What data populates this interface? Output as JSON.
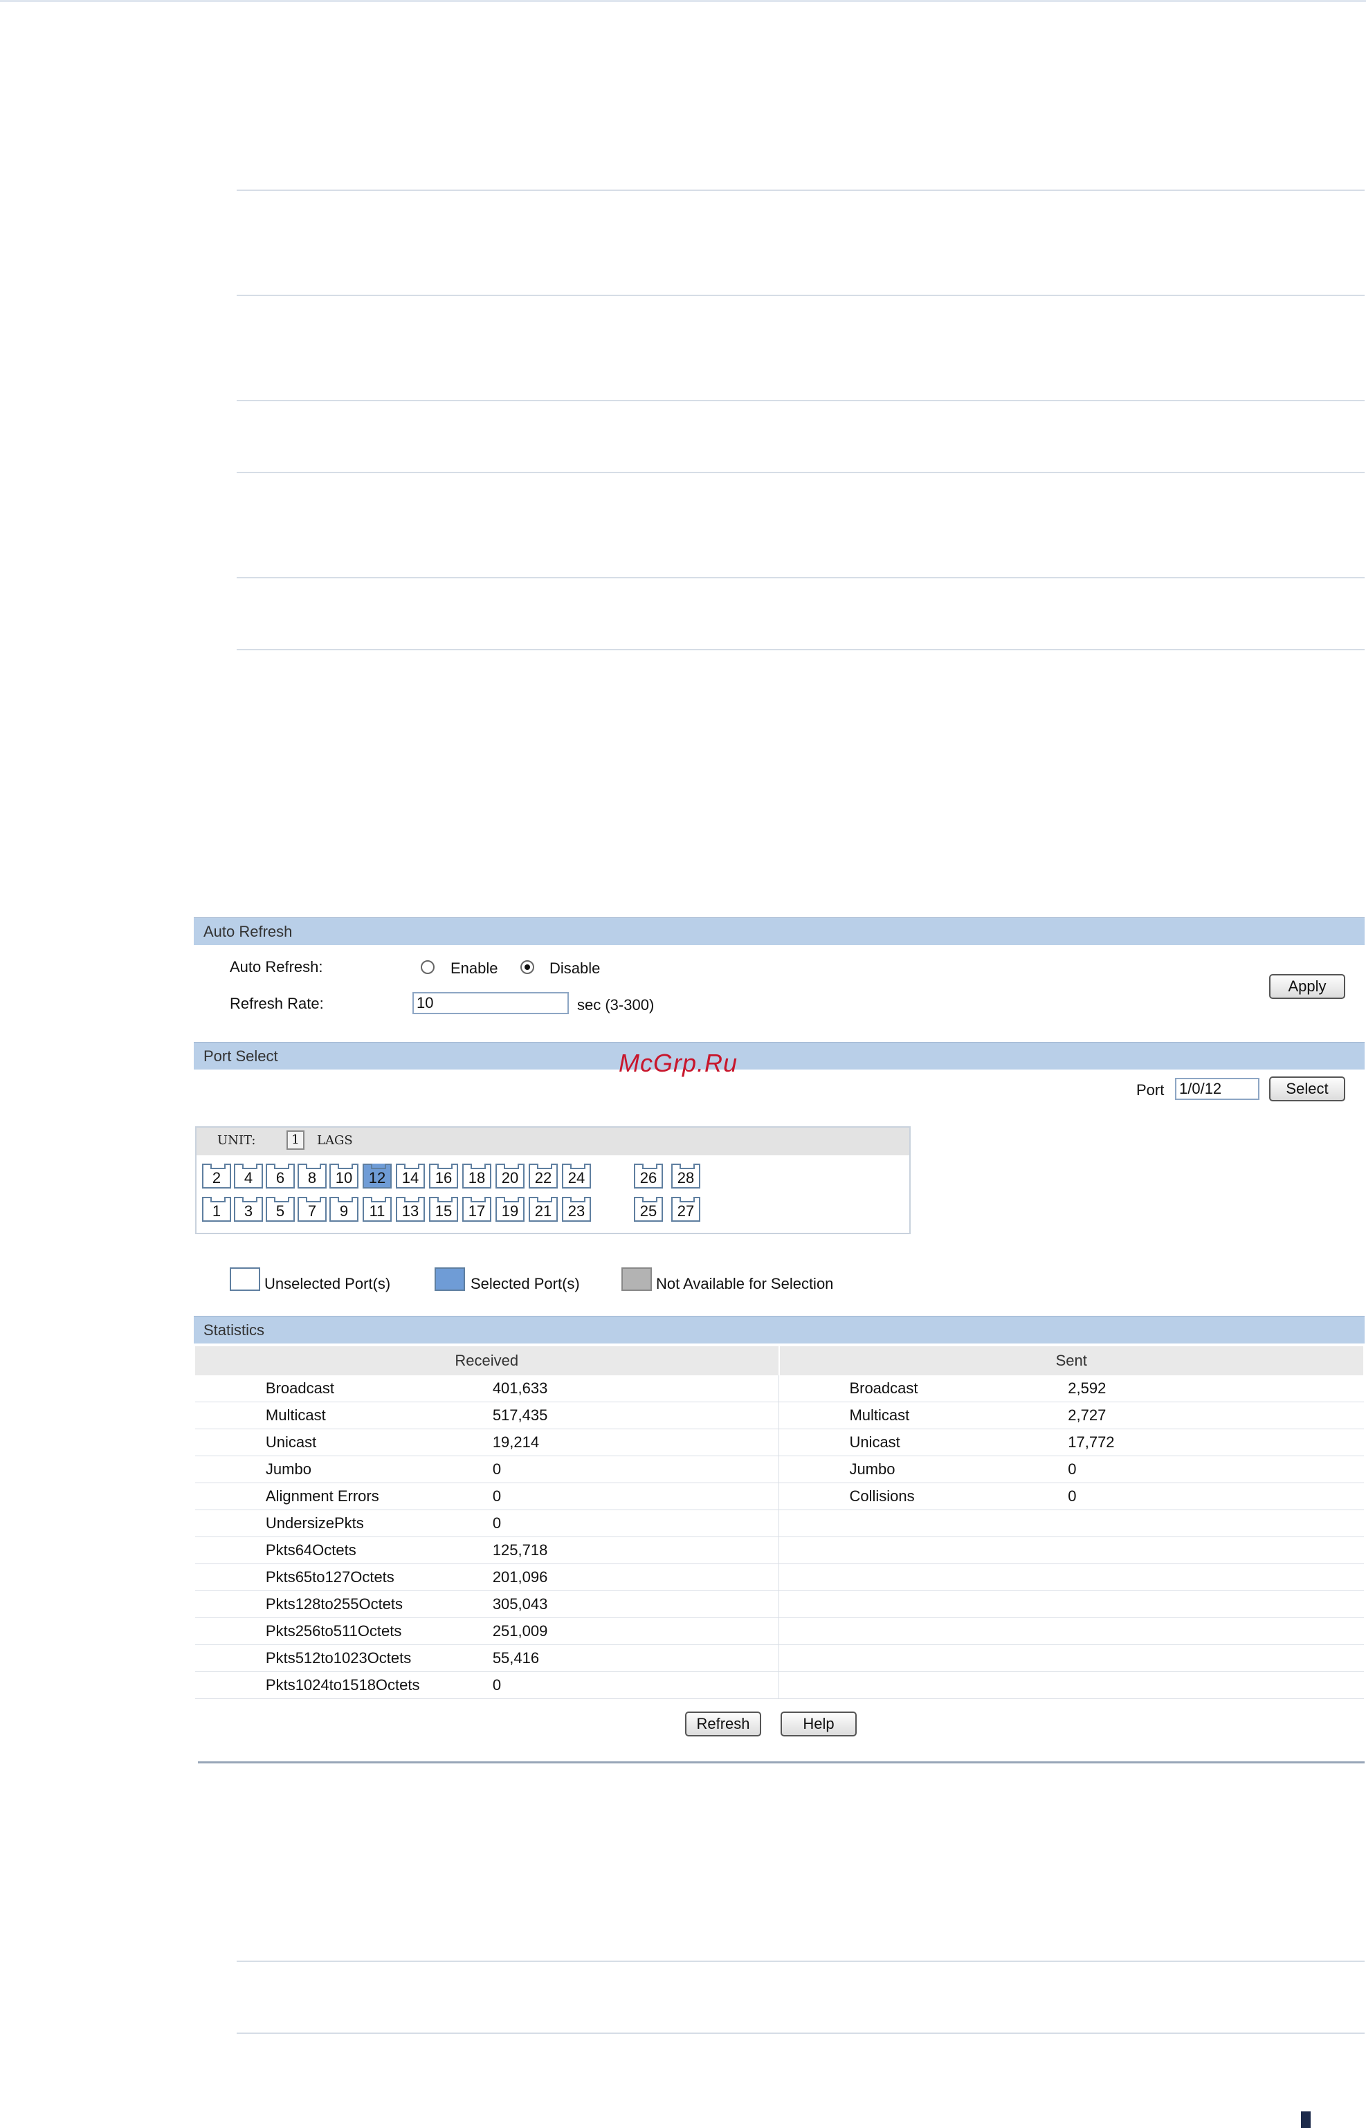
{
  "watermark": "McGrp.Ru",
  "auto_refresh": {
    "title": "Auto Refresh",
    "label": "Auto Refresh:",
    "enable_label": "Enable",
    "disable_label": "Disable",
    "selected": "Disable",
    "rate_label": "Refresh Rate:",
    "rate_value": "10",
    "rate_hint": "sec (3-300)",
    "apply_label": "Apply"
  },
  "port_select": {
    "title": "Port Select",
    "port_label": "Port",
    "port_value": "1/0/12",
    "select_label": "Select",
    "unit_label": "UNIT:",
    "unit_number": "1",
    "lags_label": "LAGS",
    "top_row": [
      "2",
      "4",
      "6",
      "8",
      "10",
      "12",
      "14",
      "16",
      "18",
      "20",
      "22",
      "24",
      "26",
      "28"
    ],
    "bottom_row": [
      "1",
      "3",
      "5",
      "7",
      "9",
      "11",
      "13",
      "15",
      "17",
      "19",
      "21",
      "23",
      "25",
      "27"
    ],
    "selected_port": "12",
    "legend": {
      "unselected": "Unselected Port(s)",
      "selected": "Selected Port(s)",
      "unavailable": "Not Available for Selection"
    },
    "colors": {
      "selected": "#6f9cd6",
      "unavailable": "#b3b3b3"
    }
  },
  "statistics": {
    "title": "Statistics",
    "received_header": "Received",
    "sent_header": "Sent",
    "rows": [
      {
        "r_label": "Broadcast",
        "r_value": "401,633",
        "s_label": "Broadcast",
        "s_value": "2,592"
      },
      {
        "r_label": "Multicast",
        "r_value": "517,435",
        "s_label": "Multicast",
        "s_value": "2,727"
      },
      {
        "r_label": "Unicast",
        "r_value": "19,214",
        "s_label": "Unicast",
        "s_value": "17,772"
      },
      {
        "r_label": "Jumbo",
        "r_value": "0",
        "s_label": "Jumbo",
        "s_value": "0"
      },
      {
        "r_label": "Alignment Errors",
        "r_value": "0",
        "s_label": "Collisions",
        "s_value": "0"
      },
      {
        "r_label": "UndersizePkts",
        "r_value": "0",
        "s_label": "",
        "s_value": ""
      },
      {
        "r_label": "Pkts64Octets",
        "r_value": "125,718",
        "s_label": "",
        "s_value": ""
      },
      {
        "r_label": "Pkts65to127Octets",
        "r_value": "201,096",
        "s_label": "",
        "s_value": ""
      },
      {
        "r_label": "Pkts128to255Octets",
        "r_value": "305,043",
        "s_label": "",
        "s_value": ""
      },
      {
        "r_label": "Pkts256to511Octets",
        "r_value": "251,009",
        "s_label": "",
        "s_value": ""
      },
      {
        "r_label": "Pkts512to1023Octets",
        "r_value": "55,416",
        "s_label": "",
        "s_value": ""
      },
      {
        "r_label": "Pkts1024to1518Octets",
        "r_value": "0",
        "s_label": "",
        "s_value": ""
      }
    ],
    "refresh_label": "Refresh",
    "help_label": "Help"
  }
}
